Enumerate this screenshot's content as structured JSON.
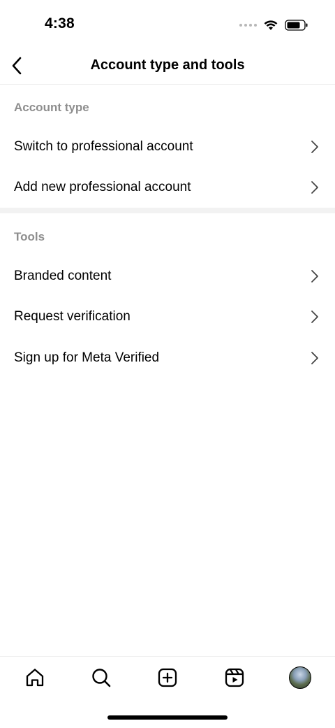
{
  "status_bar": {
    "time": "4:38",
    "icons": [
      "signal-icon",
      "wifi-icon",
      "battery-icon"
    ]
  },
  "header": {
    "title": "Account type and tools",
    "back_icon": "chevron-left-icon"
  },
  "sections": [
    {
      "title": "Account type",
      "items": [
        {
          "label": "Switch to professional account",
          "icon": "chevron-right-icon"
        },
        {
          "label": "Add new professional account",
          "icon": "chevron-right-icon"
        }
      ]
    },
    {
      "title": "Tools",
      "items": [
        {
          "label": "Branded content",
          "icon": "chevron-right-icon"
        },
        {
          "label": "Request verification",
          "icon": "chevron-right-icon"
        },
        {
          "label": "Sign up for Meta Verified",
          "icon": "chevron-right-icon"
        }
      ]
    }
  ],
  "tab_bar": {
    "tabs": [
      "home-icon",
      "search-icon",
      "create-icon",
      "reels-icon",
      "profile-avatar"
    ]
  },
  "colors": {
    "section_header": "#8e8e8e",
    "divider": "#f2f2f2",
    "text": "#000000"
  }
}
